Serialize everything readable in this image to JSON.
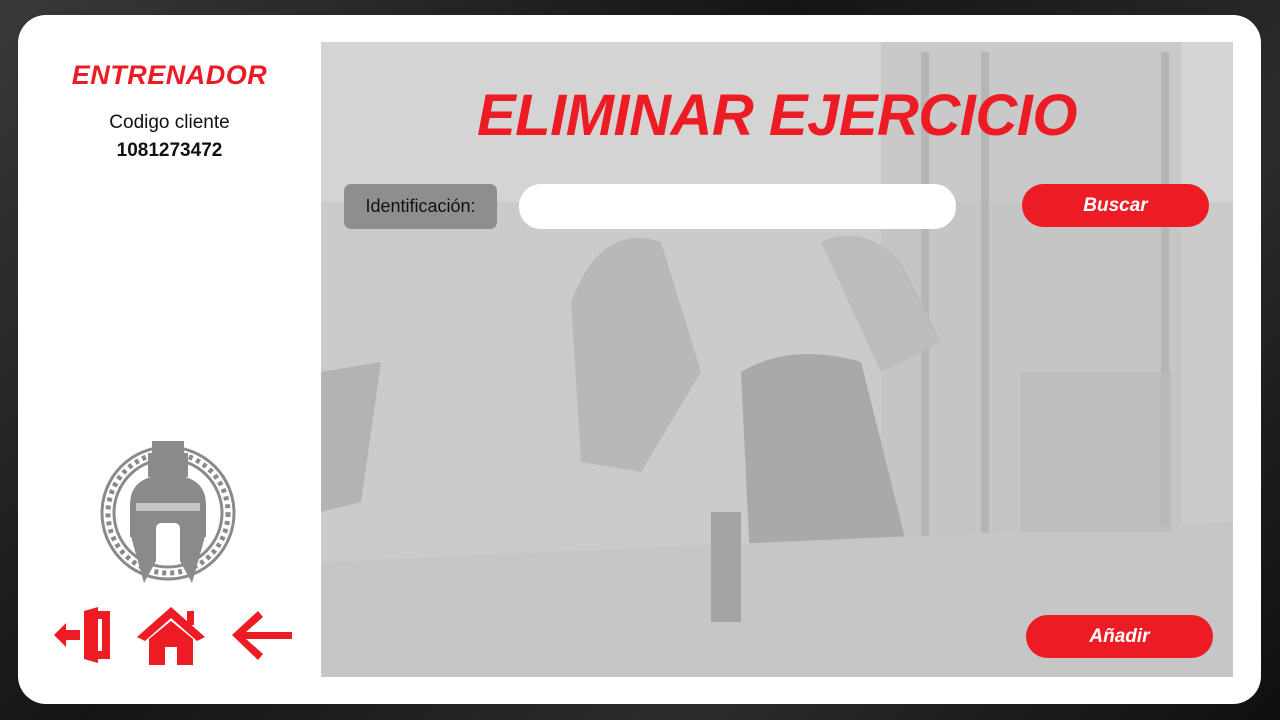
{
  "sidebar": {
    "role_title": "ENTRENADOR",
    "client_label": "Codigo cliente",
    "client_code": "1081273472",
    "logo_icon": "spartan-helmet-icon",
    "nav": [
      {
        "icon": "logout-icon"
      },
      {
        "icon": "home-icon"
      },
      {
        "icon": "back-arrow-icon"
      }
    ]
  },
  "main": {
    "title": "ELIMINAR EJERCICIO",
    "id_label": "Identificación:",
    "id_value": "",
    "id_placeholder": "",
    "search_button": "Buscar",
    "add_button": "Añadir"
  },
  "colors": {
    "accent": "#ed1c24",
    "label_bg": "#8e8e8e",
    "panel_bg": "#cfcfcf",
    "logo_gray": "#8a8a8a"
  }
}
